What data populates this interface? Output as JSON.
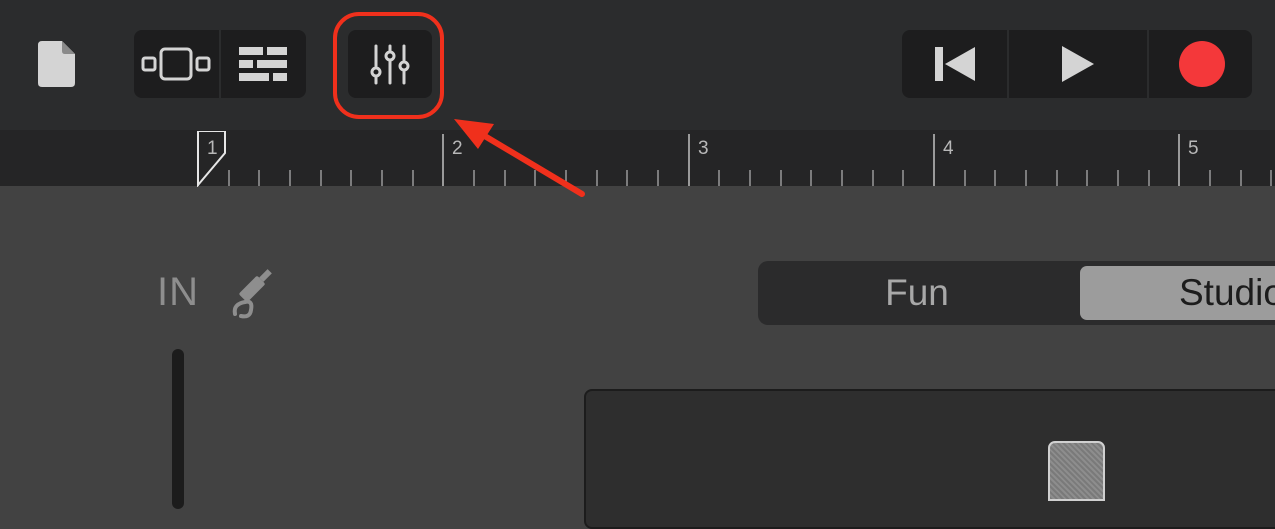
{
  "toolbar": {
    "icons": {
      "document": "document-icon",
      "tracks_view": "tracks-view-icon",
      "instrument_view": "instrument-view-icon",
      "mixer": "mixer-sliders-icon",
      "rewind": "rewind-icon",
      "play": "play-icon",
      "record": "record-icon"
    },
    "record_color": "#f4383a",
    "highlight_color": "#f0301c"
  },
  "ruler": {
    "bars": [
      "1",
      "2",
      "3",
      "4",
      "5"
    ]
  },
  "input": {
    "label": "IN",
    "icon": "audio-jack-icon"
  },
  "mode_selector": {
    "options": [
      "Fun",
      "Studio"
    ],
    "selected": "Studio"
  },
  "preview": {
    "icon": "microphone-icon"
  }
}
